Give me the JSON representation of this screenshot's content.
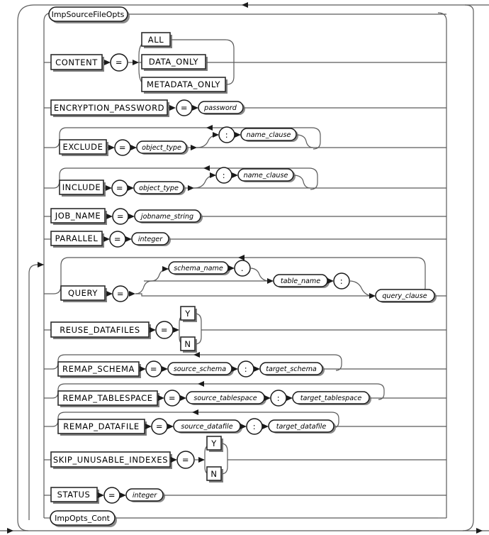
{
  "diagram": {
    "name": "impsourcefileopts-syntax-diagram",
    "type": "railroad-syntax-diagram",
    "title": "ImpSourceFileOpts",
    "entry_nonterminal": "ImpSourceFileOpts",
    "exit_nonterminal": "ImpOpts_Cont",
    "colors": {
      "background": "#ffffff",
      "rail": "#5a5a5a",
      "rail_dark": "#1a1a1a",
      "box_stroke": "#2b2b2b",
      "shadow": "#7d7d7d",
      "text": "#000000"
    },
    "rows": [
      {
        "id": "imp-source-file-opts",
        "kind": "nonterminal",
        "label": "ImpSourceFileOpts"
      },
      {
        "id": "content",
        "kind": "keyword-assign-choice",
        "keyword": "CONTENT",
        "operator": "=",
        "choices": [
          "ALL",
          "DATA_ONLY",
          "METADATA_ONLY"
        ]
      },
      {
        "id": "encryption-password",
        "kind": "keyword-assign-value",
        "keyword": "ENCRYPTION_PASSWORD",
        "operator": "=",
        "value": "password"
      },
      {
        "id": "exclude",
        "kind": "keyword-assign-value-optional-loop",
        "keyword": "EXCLUDE",
        "operator": "=",
        "value": "object_type",
        "separator": ":",
        "optional": "name_clause",
        "repeatable": true
      },
      {
        "id": "include",
        "kind": "keyword-assign-value-optional-loop",
        "keyword": "INCLUDE",
        "operator": "=",
        "value": "object_type",
        "separator": ":",
        "optional": "name_clause",
        "repeatable": true
      },
      {
        "id": "job-name",
        "kind": "keyword-assign-value",
        "keyword": "JOB_NAME",
        "operator": "=",
        "value": "jobname_string"
      },
      {
        "id": "parallel",
        "kind": "keyword-assign-value",
        "keyword": "PARALLEL",
        "operator": "=",
        "value": "integer"
      },
      {
        "id": "query",
        "kind": "keyword-assign-query",
        "keyword": "QUERY",
        "operator": "=",
        "schema": "schema_name",
        "dot": ".",
        "table": "table_name",
        "separator": ":",
        "clause": "query_clause",
        "repeatable": true
      },
      {
        "id": "reuse-datafiles",
        "kind": "keyword-assign-choice",
        "keyword": "REUSE_DATAFILES",
        "operator": "=",
        "choices": [
          "Y",
          "N"
        ]
      },
      {
        "id": "remap-schema",
        "kind": "keyword-assign-pair-loop",
        "keyword": "REMAP_SCHEMA",
        "operator": "=",
        "source": "source_schema",
        "separator": ":",
        "target": "target_schema",
        "repeatable": true
      },
      {
        "id": "remap-tablespace",
        "kind": "keyword-assign-pair-loop",
        "keyword": "REMAP_TABLESPACE",
        "operator": "=",
        "source": "source_tablespace",
        "separator": ":",
        "target": "target_tablespace",
        "repeatable": true
      },
      {
        "id": "remap-datafile",
        "kind": "keyword-assign-pair-loop",
        "keyword": "REMAP_DATAFILE",
        "operator": "=",
        "source": "source_datafile",
        "separator": ":",
        "target": "target_datafile",
        "repeatable": true
      },
      {
        "id": "skip-unusable-indexes",
        "kind": "keyword-assign-choice",
        "keyword": "SKIP_UNUSABLE_INDEXES",
        "operator": "=",
        "choices": [
          "Y",
          "N"
        ]
      },
      {
        "id": "status",
        "kind": "keyword-assign-value",
        "keyword": "STATUS",
        "operator": "=",
        "value": "integer"
      },
      {
        "id": "imp-opts-cont",
        "kind": "nonterminal",
        "label": "ImpOpts_Cont"
      }
    ],
    "labels": {
      "imp_source_file_opts": "ImpSourceFileOpts",
      "content": "CONTENT",
      "all": "ALL",
      "data_only": "DATA_ONLY",
      "metadata_only": "METADATA_ONLY",
      "encryption_password": "ENCRYPTION_PASSWORD",
      "password": "password",
      "exclude": "EXCLUDE",
      "include": "INCLUDE",
      "object_type": "object_type",
      "name_clause": "name_clause",
      "job_name": "JOB_NAME",
      "jobname_string": "jobname_string",
      "parallel": "PARALLEL",
      "integer": "integer",
      "query": "QUERY",
      "schema_name": "schema_name",
      "table_name": "table_name",
      "query_clause": "query_clause",
      "reuse_datafiles": "REUSE_DATAFILES",
      "y": "Y",
      "n": "N",
      "remap_schema": "REMAP_SCHEMA",
      "source_schema": "source_schema",
      "target_schema": "target_schema",
      "remap_tablespace": "REMAP_TABLESPACE",
      "source_tablespace": "source_tablespace",
      "target_tablespace": "target_tablespace",
      "remap_datafile": "REMAP_DATAFILE",
      "source_datafile": "source_datafile",
      "target_datafile": "target_datafile",
      "skip_unusable_indexes": "SKIP_UNUSABLE_INDEXES",
      "status": "STATUS",
      "integer2": "integer",
      "imp_opts_cont": "ImpOpts_Cont",
      "equals": "=",
      "colon": ":",
      "dot": "."
    }
  }
}
